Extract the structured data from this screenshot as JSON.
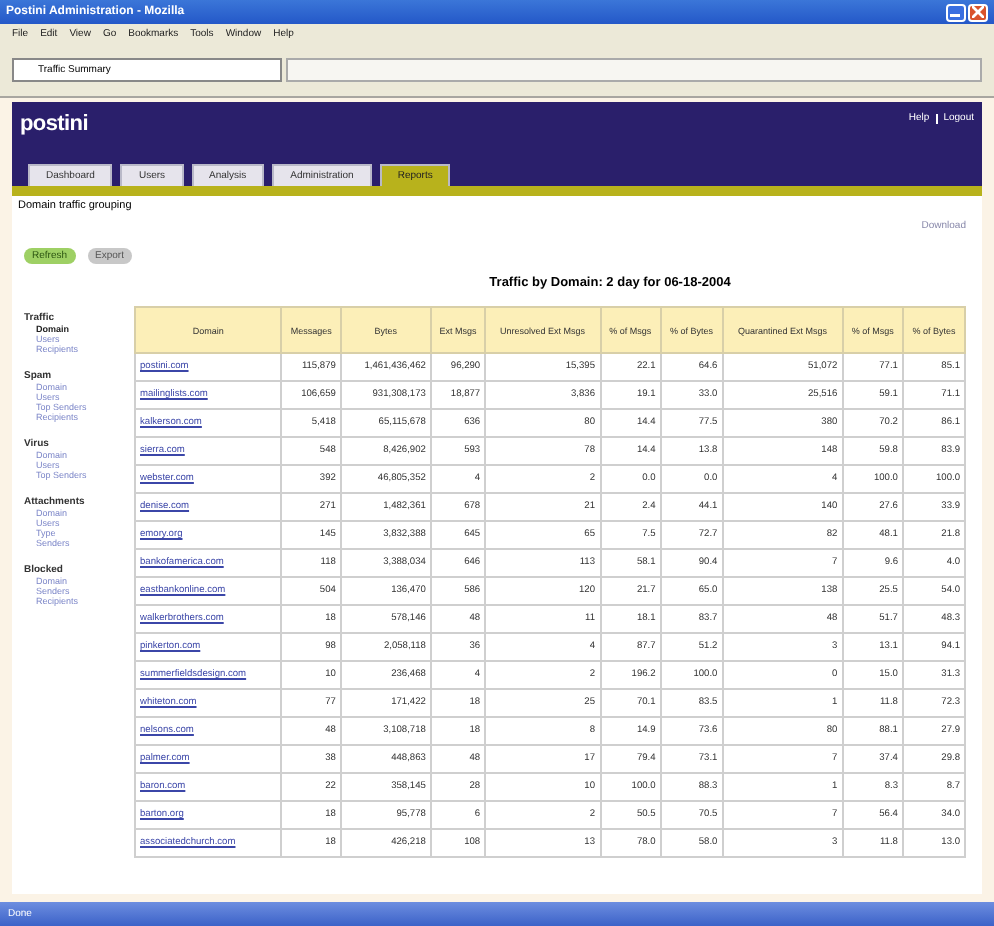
{
  "window": {
    "title": "Postini Administration - Mozilla"
  },
  "menu": [
    "File",
    "Edit",
    "View",
    "Go",
    "Bookmarks",
    "Tools",
    "Window",
    "Help"
  ],
  "browser_tab": {
    "title": "Traffic Summary"
  },
  "header": {
    "logo": "postini",
    "links": [
      "Help",
      "Logout"
    ]
  },
  "tabs": [
    {
      "label": "Dashboard",
      "selected": false
    },
    {
      "label": "Users",
      "selected": false
    },
    {
      "label": "Analysis",
      "selected": false
    },
    {
      "label": "Administration",
      "selected": false
    },
    {
      "label": "Reports",
      "selected": true
    }
  ],
  "breadcrumb": "Domain traffic grouping",
  "download": "Download",
  "buttons": [
    {
      "label": "Refresh",
      "selected": true
    },
    {
      "label": "Export",
      "selected": false
    }
  ],
  "sidebar": [
    {
      "label": "Traffic",
      "children": [
        {
          "label": "Domain",
          "selected": true
        },
        {
          "label": "Users",
          "selected": false
        },
        {
          "label": "Recipients",
          "selected": false
        }
      ]
    },
    {
      "label": "Spam",
      "children": [
        {
          "label": "Domain",
          "selected": false
        },
        {
          "label": "Users",
          "selected": false
        },
        {
          "label": "Top Senders",
          "selected": false
        },
        {
          "label": "Recipients",
          "selected": false
        }
      ]
    },
    {
      "label": "Virus",
      "children": [
        {
          "label": "Domain",
          "selected": false
        },
        {
          "label": "Users",
          "selected": false
        },
        {
          "label": "Top Senders",
          "selected": false
        }
      ]
    },
    {
      "label": "Attachments",
      "children": [
        {
          "label": "Domain",
          "selected": false
        },
        {
          "label": "Users",
          "selected": false
        },
        {
          "label": "Type",
          "selected": false
        },
        {
          "label": "Senders",
          "selected": false
        }
      ]
    },
    {
      "label": "Blocked",
      "children": [
        {
          "label": "Domain",
          "selected": false
        },
        {
          "label": "Senders",
          "selected": false
        },
        {
          "label": "Recipients",
          "selected": false
        }
      ]
    }
  ],
  "table": {
    "title": "Traffic by Domain: 2 day for 06-18-2004",
    "columns": [
      "Domain",
      "Messages",
      "Bytes",
      "Ext Msgs",
      "Unresolved Ext Msgs",
      "% of Msgs",
      "% of Bytes",
      "Quarantined Ext Msgs",
      "% of Msgs",
      "% of Bytes"
    ],
    "rows": [
      [
        "postini.com",
        "115,879",
        "1,461,436,462",
        "96,290",
        "15,395",
        "22.1",
        "64.6",
        "51,072",
        "77.1",
        "85.1"
      ],
      [
        "mailinglists.com",
        "106,659",
        "931,308,173",
        "18,877",
        "3,836",
        "19.1",
        "33.0",
        "25,516",
        "59.1",
        "71.1"
      ],
      [
        "kalkerson.com",
        "5,418",
        "65,115,678",
        "636",
        "80",
        "14.4",
        "77.5",
        "380",
        "70.2",
        "86.1"
      ],
      [
        "sierra.com",
        "548",
        "8,426,902",
        "593",
        "78",
        "14.4",
        "13.8",
        "148",
        "59.8",
        "83.9"
      ],
      [
        "webster.com",
        "392",
        "46,805,352",
        "4",
        "2",
        "0.0",
        "0.0",
        "4",
        "100.0",
        "100.0"
      ],
      [
        "denise.com",
        "271",
        "1,482,361",
        "678",
        "21",
        "2.4",
        "44.1",
        "140",
        "27.6",
        "33.9"
      ],
      [
        "emory.org",
        "145",
        "3,832,388",
        "645",
        "65",
        "7.5",
        "72.7",
        "82",
        "48.1",
        "21.8"
      ],
      [
        "bankofamerica.com",
        "118",
        "3,388,034",
        "646",
        "113",
        "58.1",
        "90.4",
        "7",
        "9.6",
        "4.0"
      ],
      [
        "eastbankonline.com",
        "504",
        "136,470",
        "586",
        "120",
        "21.7",
        "65.0",
        "138",
        "25.5",
        "54.0"
      ],
      [
        "walkerbrothers.com",
        "18",
        "578,146",
        "48",
        "11",
        "18.1",
        "83.7",
        "48",
        "51.7",
        "48.3"
      ],
      [
        "pinkerton.com",
        "98",
        "2,058,118",
        "36",
        "4",
        "87.7",
        "51.2",
        "3",
        "13.1",
        "94.1"
      ],
      [
        "summerfieldsdesign.com",
        "10",
        "236,468",
        "4",
        "2",
        "196.2",
        "100.0",
        "0",
        "15.0",
        "31.3"
      ],
      [
        "whiteton.com",
        "77",
        "171,422",
        "18",
        "25",
        "70.1",
        "83.5",
        "1",
        "11.8",
        "72.3"
      ],
      [
        "nelsons.com",
        "48",
        "3,108,718",
        "18",
        "8",
        "14.9",
        "73.6",
        "80",
        "88.1",
        "27.9"
      ],
      [
        "palmer.com",
        "38",
        "448,863",
        "48",
        "17",
        "79.4",
        "73.1",
        "7",
        "37.4",
        "29.8"
      ],
      [
        "baron.com",
        "22",
        "358,145",
        "28",
        "10",
        "100.0",
        "88.3",
        "1",
        "8.3",
        "8.7"
      ],
      [
        "barton.org",
        "18",
        "95,778",
        "6",
        "2",
        "50.5",
        "70.5",
        "7",
        "56.4",
        "34.0"
      ],
      [
        "associatedchurch.com",
        "18",
        "426,218",
        "108",
        "13",
        "78.0",
        "58.0",
        "3",
        "11.8",
        "13.0"
      ]
    ]
  },
  "status_bar": {
    "text": "Done"
  }
}
